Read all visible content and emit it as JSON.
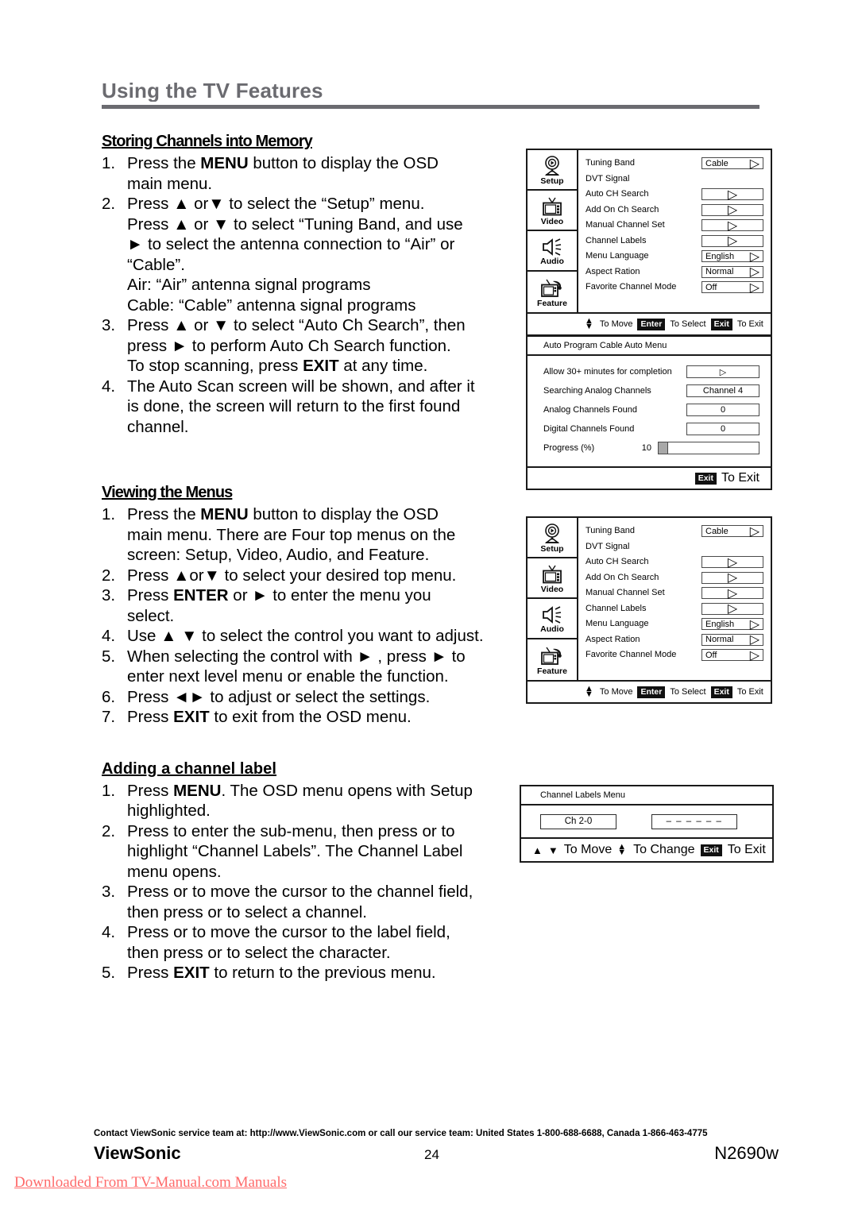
{
  "page": {
    "heading": "Using the TV Features",
    "heading_color": "#6b6b70"
  },
  "sections": [
    {
      "title": "Storing Channels into Memory",
      "steps": [
        "Press the MENU button to display the OSD main menu.",
        "Press ▲ or▼ to select the “Setup” menu.",
        "Press ▲ or ▼ to select “Auto Ch Search”, then press ► to perform Auto Ch Search function. To stop scanning, press EXIT at any time.",
        "The Auto Scan screen will be shown, and after it is done, the screen will return to the first found channel."
      ]
    },
    {
      "title": "Viewing the Menus",
      "steps": [
        "Press the MENU button to display the OSD main menu. There are Four top menus on the screen: Setup, Video, Audio, and Feature.",
        "Press ▲or▼ to select your desired top menu.",
        "Press ENTER or ► to enter the menu you select.",
        "Use ▲ ▼ to select the control you want to adjust.",
        "When selecting the control with ► , press ► to enter next level menu or enable the function.",
        "Press ◄► to adjust or select the settings.",
        "Press EXIT to exit from the OSD menu."
      ]
    },
    {
      "title": "Adding a channel label",
      "steps": [
        "Press MENU. The OSD menu opens with Setup highlighted.",
        "Press to enter the sub-menu, then press or to highlight “Channel Labels”. The Channel Label menu opens.",
        "Press or to move the cursor to the channel field, then press or to select a channel.",
        "Press or to move the cursor to the label field, then press or to select the character.",
        "Press EXIT to return to the previous menu."
      ]
    }
  ],
  "text_lines": {
    "s1_1a": "Press the ",
    "s1_1b": "MENU",
    "s1_1c": " button to display the OSD",
    "s1_1d": "main menu.",
    "s1_2a": "Press ▲ or▼ to select the “Setup” menu.",
    "s1_2b": "Press ▲ or ▼ to select “Tuning Band, and use",
    "s1_2c": "► to select the antenna connection to “Air” or",
    "s1_2d": "“Cable”.",
    "s1_2e": "Air: “Air” antenna signal programs",
    "s1_2f": "Cable: “Cable” antenna signal programs",
    "s1_3a": "Press ▲ or ▼ to select “Auto Ch Search”, then",
    "s1_3b": "press ► to perform Auto Ch Search function.",
    "s1_3c1": "To stop scanning, press ",
    "s1_3c2": "EXIT",
    "s1_3c3": " at any time.",
    "s1_4a": "The Auto Scan screen will be shown, and after it",
    "s1_4b": "is done, the screen will return to the first found",
    "s1_4c": "channel.",
    "s2_1a": "Press the ",
    "s2_1b": "MENU",
    "s2_1c": " button to display the OSD",
    "s2_1d": "main menu. There are Four top menus on the",
    "s2_1e": "screen: Setup, Video, Audio, and Feature.",
    "s2_2a": "Press ▲or▼ to select your desired top menu.",
    "s2_3a1": "Press ",
    "s2_3a2": "ENTER",
    "s2_3a3": " or ► to enter the menu you",
    "s2_3b": "select.",
    "s2_4a": "Use ▲ ▼ to select the control you want to adjust.",
    "s2_5a": "When selecting the control with ► , press ► to",
    "s2_5b": "enter next level menu or enable the function.",
    "s2_6a": "Press ◄► to adjust or select the settings.",
    "s2_7a1": "Press ",
    "s2_7a2": "EXIT",
    "s2_7a3": " to exit from the OSD menu.",
    "s3_1a1": "Press ",
    "s3_1a2": "MENU",
    "s3_1a3": ". The OSD menu opens with Setup",
    "s3_1b": "highlighted.",
    "s3_2a": "Press to enter the sub-menu, then press or to",
    "s3_2b": "highlight “Channel Labels”. The Channel Label",
    "s3_2c": "menu opens.",
    "s3_3a": "Press or to move the cursor to the channel field,",
    "s3_3b": "then press or to select a channel.",
    "s3_4a": "Press or to move the cursor to the label field,",
    "s3_4b": "then press or to select the character.",
    "s3_5a1": "Press ",
    "s3_5a2": "EXIT",
    "s3_5a3": " to return to the previous menu.",
    "n1": "1.",
    "n2": "2.",
    "n3": "3.",
    "n4": "4.",
    "n5": "5.",
    "n6": "6.",
    "n7": "7."
  },
  "osd_setup_menu": {
    "sidebar": [
      {
        "label": "Setup",
        "icon": "satellite-dish-icon"
      },
      {
        "label": "Video",
        "icon": "tv-antenna-icon"
      },
      {
        "label": "Audio",
        "icon": "speaker-icon"
      },
      {
        "label": "Feature",
        "icon": "tv-feature-icon"
      }
    ],
    "rows": [
      {
        "label": "Tuning  Band",
        "value": "Cable",
        "arrow": "▷",
        "has_field": true
      },
      {
        "label": "DVT Signal",
        "value": "",
        "arrow": "",
        "has_field": false
      },
      {
        "label": "Auto CH Search",
        "value": "",
        "arrow": "▷",
        "has_field": true
      },
      {
        "label": "Add On Ch Search",
        "value": "",
        "arrow": "▷",
        "has_field": true
      },
      {
        "label": "Manual Channel Set",
        "value": "",
        "arrow": "▷",
        "has_field": true
      },
      {
        "label": "Channel Labels",
        "value": "",
        "arrow": "▷",
        "has_field": true
      },
      {
        "label": "Menu Language",
        "value": "English",
        "arrow": "▷",
        "has_field": true
      },
      {
        "label": "Aspect Ration",
        "value": "Normal",
        "arrow": "▷",
        "has_field": true
      },
      {
        "label": "Favorite Channel Mode",
        "value": "Off",
        "arrow": "▷",
        "has_field": true
      }
    ],
    "footer": {
      "to_move": "To Move",
      "enter_key": "Enter",
      "to_select": "To Select",
      "exit_key": "Exit",
      "to_exit": "To Exit"
    }
  },
  "osd_auto_program": {
    "title": "Auto Program Cable Auto Menu",
    "rows": [
      {
        "label": "Allow 30+ minutes for completion",
        "value": "",
        "arrow": "▷"
      },
      {
        "label": "Searching Analog Channels",
        "value": "Channel 4",
        "arrow": ""
      },
      {
        "label": "Analog Channels Found",
        "value": "0",
        "arrow": ""
      },
      {
        "label": "Digital Channels Found",
        "value": "0",
        "arrow": ""
      }
    ],
    "progress": {
      "label": "Progress (%)",
      "value": "10",
      "percent": 10
    },
    "footer": {
      "exit_key": "Exit",
      "to_exit": "To Exit"
    }
  },
  "osd_channel_labels": {
    "title": "Channel Labels Menu",
    "channel_field": "Ch  2-0",
    "label_field": "– – – – – –",
    "footer": {
      "to_move": "To Move",
      "to_change": "To Change",
      "exit_key": "Exit",
      "to_exit": "To Exit"
    }
  },
  "footer": {
    "contact": "Contact ViewSonic service team at: http://www.ViewSonic.com or call our service team: United States 1-800-688-6688, Canada 1-866-463-4775",
    "brand": "ViewSonic",
    "page_number": "24",
    "model": "N2690w",
    "watermark": "Downloaded From TV-Manual.com Manuals"
  }
}
